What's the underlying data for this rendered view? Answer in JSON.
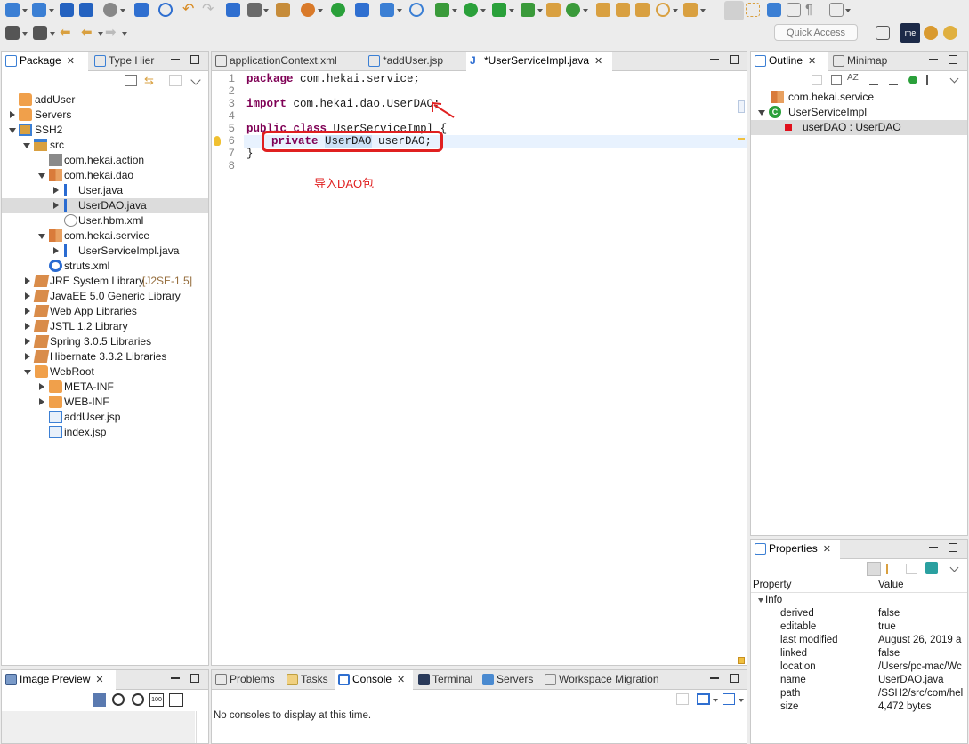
{
  "toolbar": {
    "quick_access_placeholder": "Quick Access"
  },
  "package_explorer": {
    "tabs": [
      {
        "label": "Package",
        "active": true
      },
      {
        "label": "Type Hier",
        "active": false
      }
    ],
    "items": [
      {
        "label": "addUser",
        "icon": "project-folder-icon"
      },
      {
        "label": "Servers",
        "icon": "folder-icon"
      },
      {
        "label": "SSH2",
        "icon": "project-icon"
      },
      {
        "label": "src",
        "icon": "source-folder-icon"
      },
      {
        "label": "com.hekai.action",
        "icon": "package-icon"
      },
      {
        "label": "com.hekai.dao",
        "icon": "package-icon"
      },
      {
        "label": "User.java",
        "icon": "java-file-icon"
      },
      {
        "label": "UserDAO.java",
        "icon": "java-file-icon"
      },
      {
        "label": "User.hbm.xml",
        "icon": "xml-file-icon"
      },
      {
        "label": "com.hekai.service",
        "icon": "package-icon"
      },
      {
        "label": "UserServiceImpl.java",
        "icon": "java-file-icon"
      },
      {
        "label": "struts.xml",
        "icon": "gear-file-icon"
      },
      {
        "label": "JRE System Library",
        "suffix": "[J2SE-1.5]",
        "icon": "library-icon"
      },
      {
        "label": "JavaEE 5.0 Generic Library",
        "icon": "library-icon"
      },
      {
        "label": "Web App Libraries",
        "icon": "library-icon"
      },
      {
        "label": "JSTL 1.2 Library",
        "icon": "library-icon"
      },
      {
        "label": "Spring 3.0.5 Libraries",
        "icon": "library-icon"
      },
      {
        "label": "Hibernate 3.3.2 Libraries",
        "icon": "library-icon"
      },
      {
        "label": "WebRoot",
        "icon": "folder-icon"
      },
      {
        "label": "META-INF",
        "icon": "folder-icon"
      },
      {
        "label": "WEB-INF",
        "icon": "folder-icon"
      },
      {
        "label": "addUser.jsp",
        "icon": "jsp-file-icon"
      },
      {
        "label": "index.jsp",
        "icon": "jsp-file-icon"
      }
    ]
  },
  "editor": {
    "tabs": [
      {
        "label": "applicationContext.xml",
        "active": false
      },
      {
        "label": "*addUser.jsp",
        "active": false
      },
      {
        "label": "*UserServiceImpl.java",
        "active": true
      }
    ],
    "line_numbers": [
      "1",
      "2",
      "3",
      "4",
      "5",
      "6",
      "7",
      "8"
    ],
    "lines": {
      "l1_kw": "package",
      "l1_rest": " com.hekai.service;",
      "l3_kw": "import",
      "l3_rest": " com.hekai.dao.UserDAO;",
      "l5_kw1": "public",
      "l5_mid": " ",
      "l5_kw2": "class",
      "l5_rest": " UserServiceImpl {",
      "l6_kw": "private",
      "l6_type": "UserDAO",
      "l6_rest": " userDAO;",
      "l7": "}"
    },
    "annotation_text": "导入DAO包",
    "annotation_color": "#e02020"
  },
  "outline": {
    "tabs": [
      {
        "label": "Outline",
        "active": true
      },
      {
        "label": "Minimap",
        "active": false
      }
    ],
    "items": [
      {
        "label": "com.hekai.service"
      },
      {
        "label": "UserServiceImpl"
      },
      {
        "label": "userDAO : UserDAO"
      }
    ]
  },
  "properties": {
    "tab_label": "Properties",
    "col_property": "Property",
    "col_value": "Value",
    "group": "Info",
    "rows": [
      {
        "name": "derived",
        "value": "false"
      },
      {
        "name": "editable",
        "value": "true"
      },
      {
        "name": "last modified",
        "value": "August 26, 2019 a"
      },
      {
        "name": "linked",
        "value": "false"
      },
      {
        "name": "location",
        "value": "/Users/pc-mac/Wc"
      },
      {
        "name": "name",
        "value": "UserDAO.java"
      },
      {
        "name": "path",
        "value": "/SSH2/src/com/hel"
      },
      {
        "name": "size",
        "value": "4,472  bytes"
      }
    ]
  },
  "image_preview": {
    "tab_label": "Image Preview"
  },
  "console": {
    "tabs": [
      {
        "label": "Problems",
        "active": false
      },
      {
        "label": "Tasks",
        "active": false
      },
      {
        "label": "Console",
        "active": true
      },
      {
        "label": "Terminal",
        "active": false
      },
      {
        "label": "Servers",
        "active": false
      },
      {
        "label": "Workspace Migration",
        "active": false
      }
    ],
    "message": "No consoles to display at this time."
  }
}
